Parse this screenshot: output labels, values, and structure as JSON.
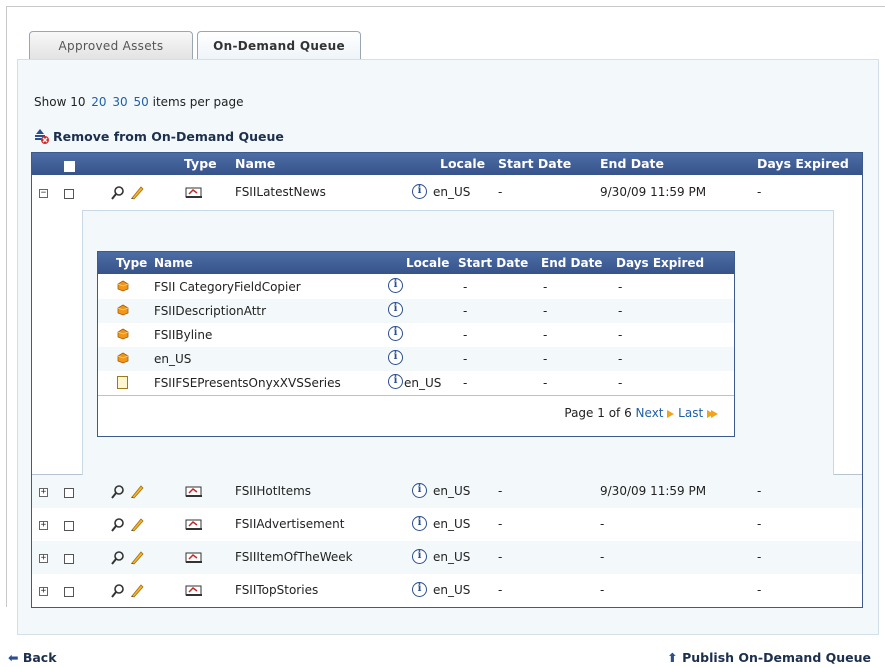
{
  "tabs": [
    {
      "label": "Approved Assets",
      "active": false
    },
    {
      "label": "On-Demand Queue",
      "active": true
    }
  ],
  "per_page": {
    "prefix": "Show 10",
    "options": [
      "20",
      "30",
      "50"
    ],
    "suffix": "items per page"
  },
  "toolbar": {
    "remove_label": "Remove from On-Demand Queue"
  },
  "table": {
    "columns": [
      "Type",
      "Name",
      "Locale",
      "Start Date",
      "End Date",
      "Days Expired"
    ],
    "rows": [
      {
        "name": "FSIILatestNews",
        "locale": "en_US",
        "start": "-",
        "end": "9/30/09 11:59 PM",
        "expired": "-",
        "expanded": true
      },
      {
        "name": "FSIIHotItems",
        "locale": "en_US",
        "start": "-",
        "end": "9/30/09 11:59 PM",
        "expired": "-",
        "expanded": false
      },
      {
        "name": "FSIIAdvertisement",
        "locale": "en_US",
        "start": "-",
        "end": "-",
        "expired": "-",
        "expanded": false
      },
      {
        "name": "FSIIItemOfTheWeek",
        "locale": "en_US",
        "start": "-",
        "end": "-",
        "expired": "-",
        "expanded": false
      },
      {
        "name": "FSIITopStories",
        "locale": "en_US",
        "start": "-",
        "end": "-",
        "expired": "-",
        "expanded": false
      }
    ]
  },
  "subtable": {
    "columns": [
      "Type",
      "Name",
      "Locale",
      "Start Date",
      "End Date",
      "Days Expired"
    ],
    "rows": [
      {
        "name": "FSII CategoryFieldCopier",
        "locale": "",
        "start": "-",
        "end": "-",
        "expired": "-",
        "icon": "component-icon"
      },
      {
        "name": "FSIIDescriptionAttr",
        "locale": "",
        "start": "-",
        "end": "-",
        "expired": "-",
        "icon": "component-icon"
      },
      {
        "name": "FSIIByline",
        "locale": "",
        "start": "-",
        "end": "-",
        "expired": "-",
        "icon": "component-icon"
      },
      {
        "name": "en_US",
        "locale": "",
        "start": "-",
        "end": "-",
        "expired": "-",
        "icon": "component-icon"
      },
      {
        "name": "FSIIFSEPresentsOnyxXVSSeries",
        "locale": "en_US",
        "start": "-",
        "end": "-",
        "expired": "-",
        "icon": "page-icon"
      }
    ],
    "pager": {
      "page_text": "Page 1 of 6",
      "next_label": "Next",
      "last_label": "Last"
    }
  },
  "footer": {
    "back_label": "Back",
    "publish_label": "Publish On-Demand Queue"
  },
  "colors": {
    "header_bg": "#3f5f98",
    "panel_bg": "#f3f9fb",
    "link": "#1f5fa8",
    "accent_arrow": "#f0a418"
  }
}
